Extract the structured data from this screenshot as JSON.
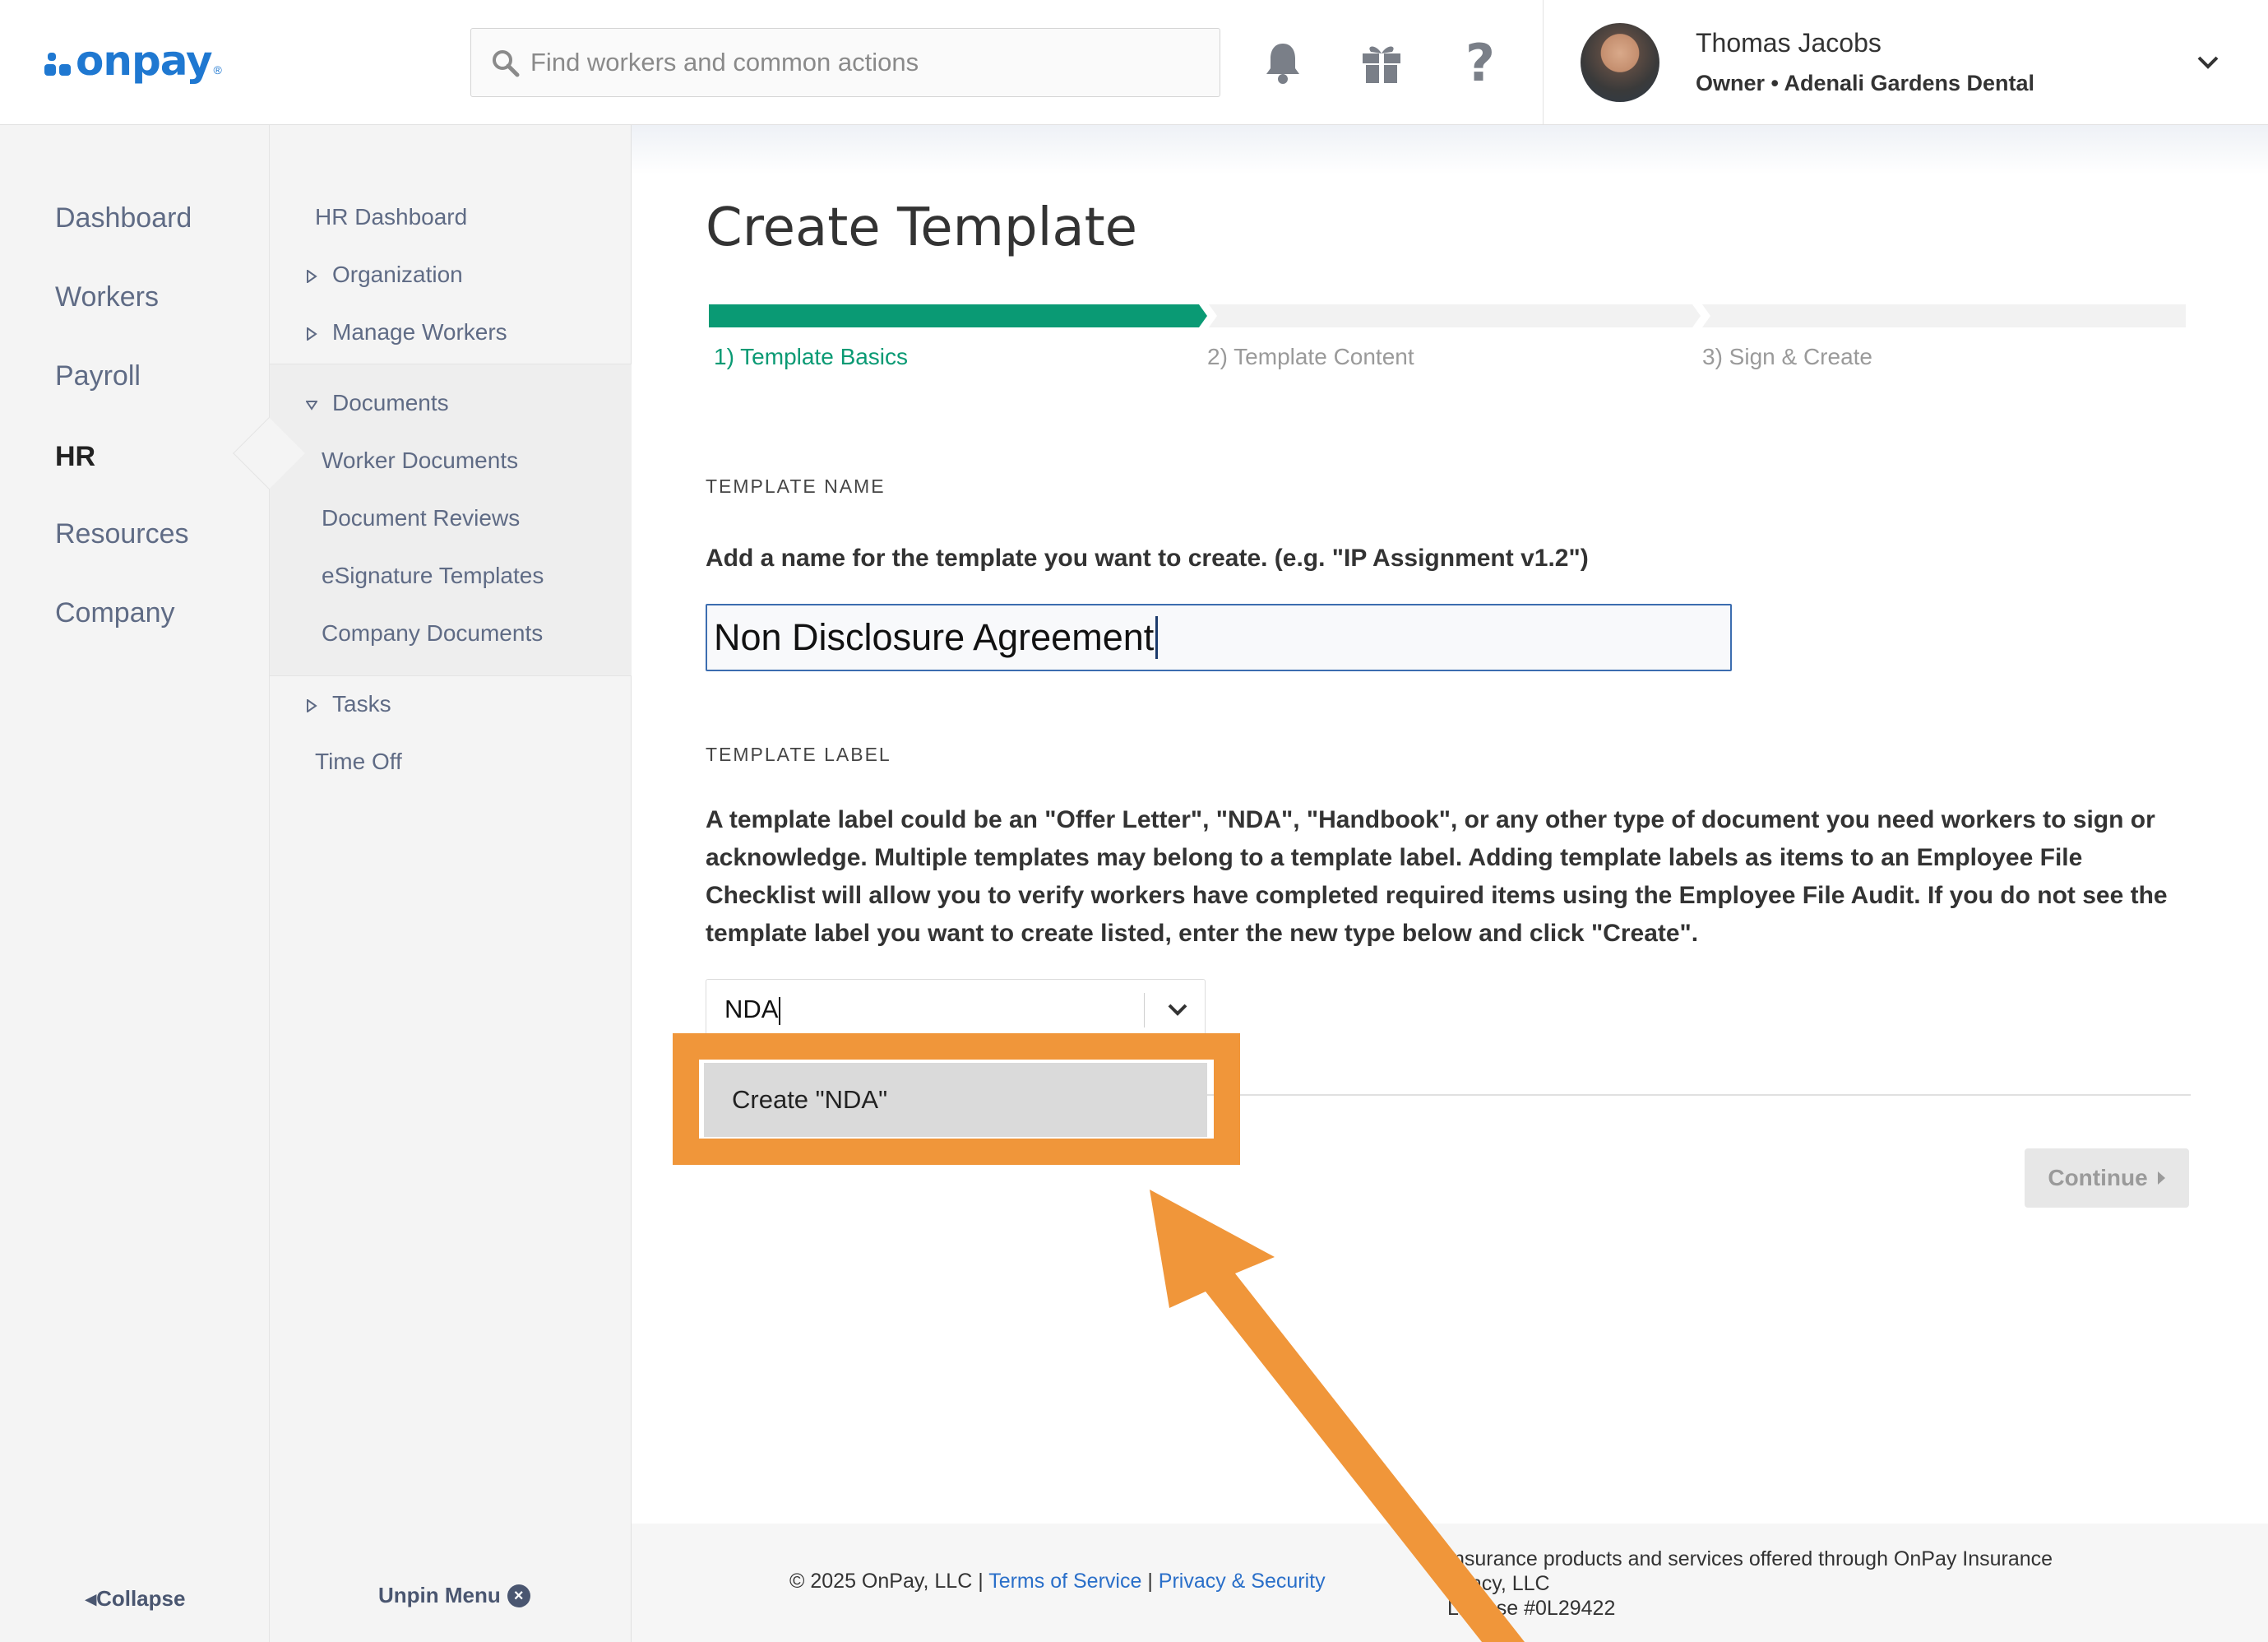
{
  "brand": {
    "name": "onpay",
    "accent": "#1f78d1"
  },
  "header": {
    "search_placeholder": "Find workers and common actions",
    "user_name": "Thomas Jacobs",
    "user_role": "Owner • Adenali Gardens Dental",
    "icons": [
      "bell-icon",
      "gift-icon",
      "help-icon",
      "chevron-down-icon"
    ]
  },
  "sidebar": {
    "items": [
      {
        "label": "Dashboard",
        "active": false
      },
      {
        "label": "Workers",
        "active": false
      },
      {
        "label": "Payroll",
        "active": false
      },
      {
        "label": "HR",
        "active": true
      },
      {
        "label": "Resources",
        "active": false
      },
      {
        "label": "Company",
        "active": false
      }
    ],
    "collapse_label": "Collapse"
  },
  "subnav": {
    "hr_dashboard": "HR Dashboard",
    "organization": "Organization",
    "manage_workers": "Manage Workers",
    "documents": "Documents",
    "worker_documents": "Worker Documents",
    "document_reviews": "Document Reviews",
    "esignature_templates": "eSignature Templates",
    "company_documents": "Company Documents",
    "tasks": "Tasks",
    "time_off": "Time Off",
    "unpin_label": "Unpin Menu"
  },
  "main": {
    "title": "Create Template",
    "steps": [
      {
        "label": "1) Template Basics",
        "active": true
      },
      {
        "label": "2) Template Content",
        "active": false
      },
      {
        "label": "3) Sign & Create",
        "active": false
      }
    ],
    "step_active_color": "#0a9a74",
    "template_name": {
      "section_label": "TEMPLATE NAME",
      "help": "Add a name for the template you want to create. (e.g. \"IP Assignment v1.2\")",
      "value": "Non Disclosure Agreement"
    },
    "template_label": {
      "section_label": "TEMPLATE LABEL",
      "help": "A template label could be an \"Offer Letter\", \"NDA\", \"Handbook\", or any other type of document you need workers to sign or acknowledge. Multiple templates may belong to a template label. Adding template labels as items to an Employee File Checklist will allow you to verify workers have completed required items using the Employee File Audit. If you do not see the template label you want to create listed, enter the new type below and click \"Create\".",
      "value": "NDA",
      "dropdown_option": "Create \"NDA\""
    },
    "continue_label": "Continue"
  },
  "footer": {
    "copyright": "© 2025 OnPay, LLC |",
    "terms": "Terms of Service",
    "sep": "|",
    "privacy": "Privacy & Security",
    "insurance_line1": "Insurance products and services offered through OnPay Insurance",
    "insurance_line2": "gency, LLC",
    "insurance_line3": "License #0L29422"
  },
  "annotation": {
    "highlight_color": "#f0963a"
  }
}
